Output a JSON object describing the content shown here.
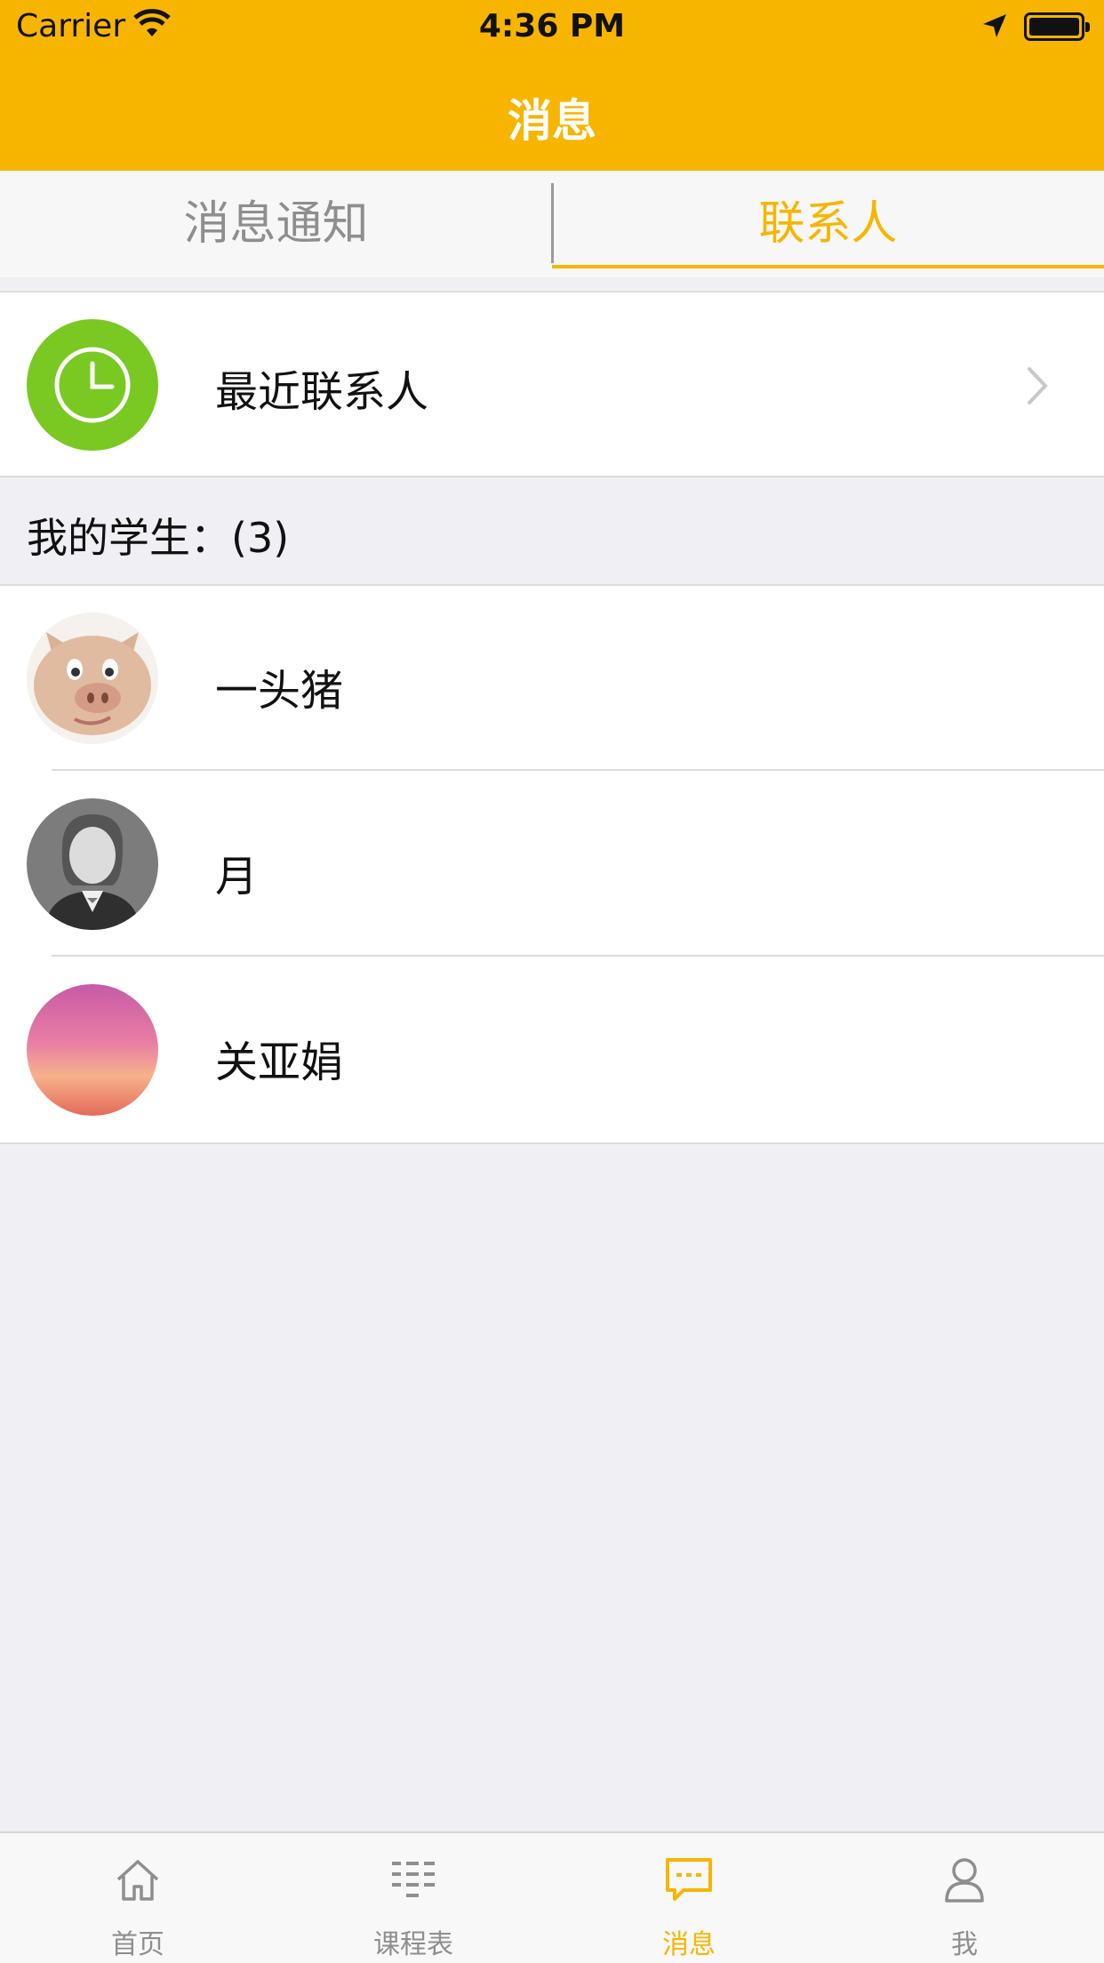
{
  "status_bar": {
    "carrier": "Carrier",
    "time": "4:36 PM"
  },
  "nav": {
    "title": "消息"
  },
  "segmented_tabs": [
    {
      "label": "消息通知",
      "selected": false
    },
    {
      "label": "联系人",
      "selected": true
    }
  ],
  "recent_contacts": {
    "label": "最近联系人",
    "icon": "clock-icon"
  },
  "students_section": {
    "header": "我的学生：(3)"
  },
  "students": [
    {
      "name": "一头猪",
      "avatar": "pig-avatar"
    },
    {
      "name": "月",
      "avatar": "default-user-avatar"
    },
    {
      "name": "关亚娟",
      "avatar": "sunset-avatar"
    }
  ],
  "tab_bar": [
    {
      "label": "首页",
      "icon": "home-icon",
      "active": false
    },
    {
      "label": "课程表",
      "icon": "schedule-icon",
      "active": false
    },
    {
      "label": "消息",
      "icon": "message-icon",
      "active": true
    },
    {
      "label": "我",
      "icon": "profile-icon",
      "active": false
    }
  ],
  "colors": {
    "accent": "#f7b500",
    "clock_green": "#79c922",
    "background": "#efeff4"
  }
}
